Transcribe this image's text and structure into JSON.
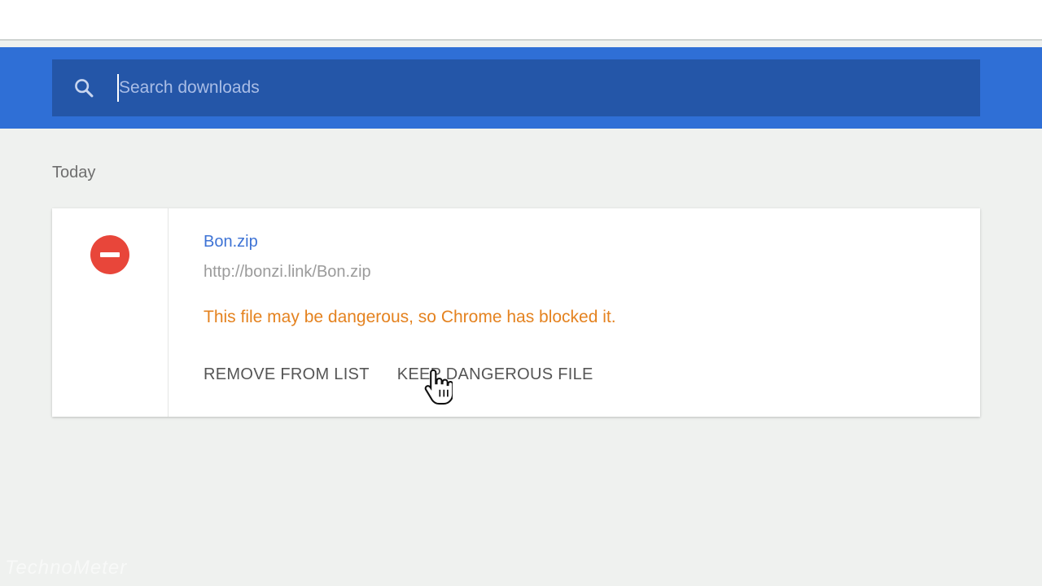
{
  "search": {
    "placeholder": "Search downloads",
    "icon": "search-icon"
  },
  "section": {
    "label": "Today"
  },
  "download": {
    "icon": "blocked-icon",
    "file_name": "Bon.zip",
    "url": "http://bonzi.link/Bon.zip",
    "warning": "This file may be dangerous, so Chrome has blocked it.",
    "actions": {
      "remove": "REMOVE FROM LIST",
      "keep": "KEEP DANGEROUS FILE"
    }
  },
  "watermark": "TechnoMeter",
  "colors": {
    "toolbar": "#2f6fd6",
    "search_box": "#2456a8",
    "link": "#3e73d5",
    "warning": "#e4821f",
    "blocked": "#e8463a"
  }
}
